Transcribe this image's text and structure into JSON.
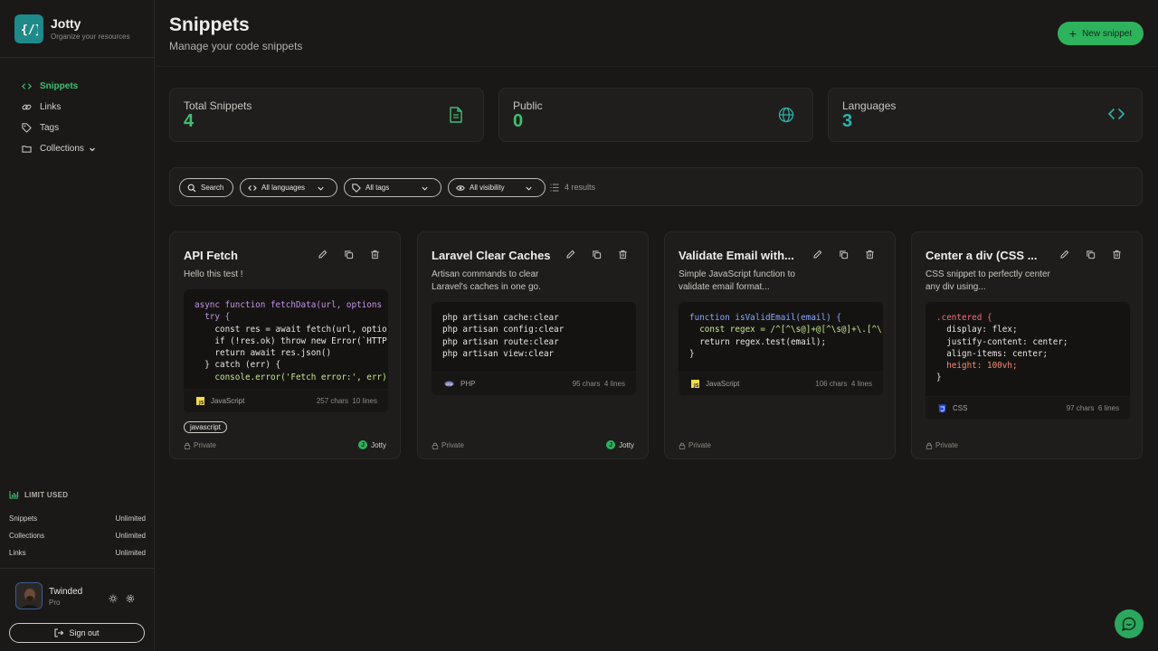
{
  "brand": {
    "name": "Jotty",
    "subtitle": "Organize your resources"
  },
  "nav": [
    {
      "label": "Snippets",
      "icon": "code-icon",
      "active": true
    },
    {
      "label": "Links",
      "icon": "link-icon"
    },
    {
      "label": "Tags",
      "icon": "tag-icon"
    },
    {
      "label": "Collections",
      "icon": "folder-icon"
    }
  ],
  "limits": {
    "title": "LIMIT USED",
    "rows": [
      {
        "label": "Snippets",
        "value": "Unlimited"
      },
      {
        "label": "Collections",
        "value": "Unlimited"
      },
      {
        "label": "Links",
        "value": "Unlimited"
      }
    ]
  },
  "user": {
    "name": "Twinded",
    "plan": "Pro",
    "signout_label": "Sign out"
  },
  "header": {
    "title": "Snippets",
    "subtitle": "Manage your code snippets",
    "new_label": "New snippet"
  },
  "stats": [
    {
      "label": "Total Snippets",
      "value": "4",
      "color": "#3fbf73",
      "icon": "file-icon"
    },
    {
      "label": "Public",
      "value": "0",
      "color": "#3fbf73",
      "icon": "globe-icon"
    },
    {
      "label": "Languages",
      "value": "3",
      "color": "#2bb5ac",
      "icon": "code-icon"
    }
  ],
  "filters": {
    "search_label": "Search",
    "languages_label": "All languages",
    "tags_label": "All tags",
    "visibility_label": "All visibility",
    "results_label": "4 results"
  },
  "snippets": [
    {
      "title": "API Fetch",
      "description": "Hello this test !",
      "language": "JavaScript",
      "chars": "257 chars",
      "lines": "10 lines",
      "tag": "javascript",
      "visibility": "Private",
      "owner": "Jotty"
    },
    {
      "title": "Laravel Clear Caches",
      "description": "Artisan commands to clear Laravel's caches in one go.",
      "language": "PHP",
      "chars": "95 chars",
      "lines": "4 lines",
      "visibility": "Private",
      "owner": "Jotty"
    },
    {
      "title": "Validate Email with...",
      "description": "Simple JavaScript function to validate email format...",
      "language": "JavaScript",
      "chars": "106 chars",
      "lines": "4 lines",
      "visibility": "Private"
    },
    {
      "title": "Center a div (CSS ...",
      "description": "CSS snippet to perfectly center any div using...",
      "language": "CSS",
      "chars": "97 chars",
      "lines": "6 lines",
      "visibility": "Private"
    }
  ],
  "code": {
    "api_fetch": [
      "async function fetchData(url, options",
      "  try {",
      "    const res = await fetch(url, optio",
      "    if (!res.ok) throw new Error(`HTTP",
      "    return await res.json()",
      "  } catch (err) {",
      "    console.error('Fetch error:', err)"
    ],
    "laravel": [
      "php artisan cache:clear",
      "php artisan config:clear",
      "php artisan route:clear",
      "php artisan view:clear"
    ],
    "validate": [
      "function isValidEmail(email) {",
      "  const regex = /^[^\\s@]+@[^\\s@]+\\.[^\\",
      "  return regex.test(email);",
      "}"
    ],
    "center": [
      ".centered {",
      "  display: flex;",
      "  justify-content: center;",
      "  align-items: center;",
      "  height: 100vh;",
      "}"
    ]
  },
  "colors": {
    "accent": "#3fbf73",
    "teal": "#2bb5ac",
    "background": "#1a1817"
  }
}
